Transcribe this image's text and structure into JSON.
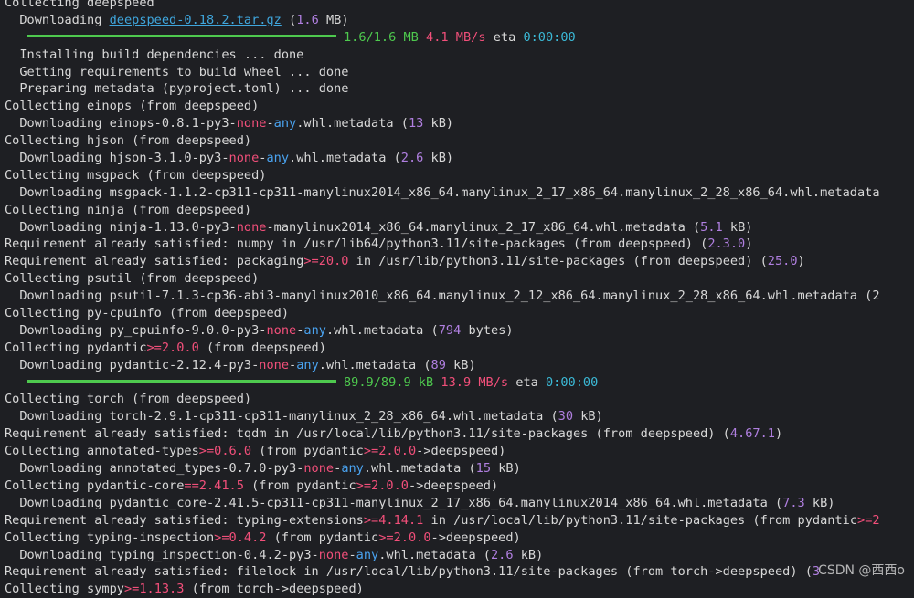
{
  "terminal": {
    "lines": [
      [
        [
          "Collecting deepspeed",
          ""
        ]
      ],
      [
        [
          "  Downloading ",
          ""
        ],
        [
          "deepspeed-0.18.2.tar.gz",
          "u"
        ],
        [
          " (",
          ""
        ],
        [
          "1.6",
          "m"
        ],
        [
          " MB)",
          ""
        ]
      ],
      [
        [
          "__BAR__",
          ""
        ],
        [
          "1.6/1.6 MB",
          "g"
        ],
        [
          " ",
          ""
        ],
        [
          "4.1 MB/s",
          "r"
        ],
        [
          " eta ",
          ""
        ],
        [
          "0:00:00",
          "c"
        ]
      ],
      [
        [
          "  Installing build dependencies ... done",
          ""
        ]
      ],
      [
        [
          "  Getting requirements to build wheel ... done",
          ""
        ]
      ],
      [
        [
          "  Preparing metadata (pyproject.toml) ... done",
          ""
        ]
      ],
      [
        [
          "Collecting einops (from deepspeed)",
          ""
        ]
      ],
      [
        [
          "  Downloading einops-0.8.1-py3-",
          ""
        ],
        [
          "none",
          "r"
        ],
        [
          "-",
          ""
        ],
        [
          "any",
          "b"
        ],
        [
          ".whl.metadata (",
          ""
        ],
        [
          "13",
          "m"
        ],
        [
          " kB)",
          ""
        ]
      ],
      [
        [
          "Collecting hjson (from deepspeed)",
          ""
        ]
      ],
      [
        [
          "  Downloading hjson-3.1.0-py3-",
          ""
        ],
        [
          "none",
          "r"
        ],
        [
          "-",
          ""
        ],
        [
          "any",
          "b"
        ],
        [
          ".whl.metadata (",
          ""
        ],
        [
          "2.6",
          "m"
        ],
        [
          " kB)",
          ""
        ]
      ],
      [
        [
          "Collecting msgpack (from deepspeed)",
          ""
        ]
      ],
      [
        [
          "  Downloading msgpack-1.1.2-cp311-cp311-manylinux2014_x86_64.manylinux_2_17_x86_64.manylinux_2_28_x86_64.whl.metadata",
          ""
        ]
      ],
      [
        [
          "Collecting ninja (from deepspeed)",
          ""
        ]
      ],
      [
        [
          "  Downloading ninja-1.13.0-py3-",
          ""
        ],
        [
          "none",
          "r"
        ],
        [
          "-manylinux2014_x86_64.manylinux_2_17_x86_64.whl.metadata (",
          ""
        ],
        [
          "5.1",
          "m"
        ],
        [
          " kB)",
          ""
        ]
      ],
      [
        [
          "Requirement already satisfied: numpy in /usr/lib64/python3.11/site-packages (from deepspeed) (",
          ""
        ],
        [
          "2.3.0",
          "m"
        ],
        [
          ")",
          ""
        ]
      ],
      [
        [
          "Requirement already satisfied: packaging",
          ""
        ],
        [
          ">=20.0",
          "r"
        ],
        [
          " in /usr/lib/python3.11/site-packages (from deepspeed) (",
          ""
        ],
        [
          "25.0",
          "m"
        ],
        [
          ")",
          ""
        ]
      ],
      [
        [
          "Collecting psutil (from deepspeed)",
          ""
        ]
      ],
      [
        [
          "  Downloading psutil-7.1.3-cp36-abi3-manylinux2010_x86_64.manylinux_2_12_x86_64.manylinux_2_28_x86_64.whl.metadata (2",
          ""
        ]
      ],
      [
        [
          "Collecting py-cpuinfo (from deepspeed)",
          ""
        ]
      ],
      [
        [
          "  Downloading py_cpuinfo-9.0.0-py3-",
          ""
        ],
        [
          "none",
          "r"
        ],
        [
          "-",
          ""
        ],
        [
          "any",
          "b"
        ],
        [
          ".whl.metadata (",
          ""
        ],
        [
          "794",
          "m"
        ],
        [
          " bytes)",
          ""
        ]
      ],
      [
        [
          "Collecting pydantic",
          ""
        ],
        [
          ">=2.0.0",
          "r"
        ],
        [
          " (from deepspeed)",
          ""
        ]
      ],
      [
        [
          "  Downloading pydantic-2.12.4-py3-",
          ""
        ],
        [
          "none",
          "r"
        ],
        [
          "-",
          ""
        ],
        [
          "any",
          "b"
        ],
        [
          ".whl.metadata (",
          ""
        ],
        [
          "89",
          "m"
        ],
        [
          " kB)",
          ""
        ]
      ],
      [
        [
          "__BAR__",
          ""
        ],
        [
          "89.9/89.9 kB",
          "g"
        ],
        [
          " ",
          ""
        ],
        [
          "13.9 MB/s",
          "r"
        ],
        [
          " eta ",
          ""
        ],
        [
          "0:00:00",
          "c"
        ]
      ],
      [
        [
          "Collecting torch (from deepspeed)",
          ""
        ]
      ],
      [
        [
          "  Downloading torch-2.9.1-cp311-cp311-manylinux_2_28_x86_64.whl.metadata (",
          ""
        ],
        [
          "30",
          "m"
        ],
        [
          " kB)",
          ""
        ]
      ],
      [
        [
          "Requirement already satisfied: tqdm in /usr/local/lib/python3.11/site-packages (from deepspeed) (",
          ""
        ],
        [
          "4.67.1",
          "m"
        ],
        [
          ")",
          ""
        ]
      ],
      [
        [
          "Collecting annotated-types",
          ""
        ],
        [
          ">=0.6.0",
          "r"
        ],
        [
          " (from pydantic",
          ""
        ],
        [
          ">=2.0.0",
          "r"
        ],
        [
          "->deepspeed)",
          ""
        ]
      ],
      [
        [
          "  Downloading annotated_types-0.7.0-py3-",
          ""
        ],
        [
          "none",
          "r"
        ],
        [
          "-",
          ""
        ],
        [
          "any",
          "b"
        ],
        [
          ".whl.metadata (",
          ""
        ],
        [
          "15",
          "m"
        ],
        [
          " kB)",
          ""
        ]
      ],
      [
        [
          "Collecting pydantic-core",
          ""
        ],
        [
          "==2.41.5",
          "r"
        ],
        [
          " (from pydantic",
          ""
        ],
        [
          ">=2.0.0",
          "r"
        ],
        [
          "->deepspeed)",
          ""
        ]
      ],
      [
        [
          "  Downloading pydantic_core-2.41.5-cp311-cp311-manylinux_2_17_x86_64.manylinux2014_x86_64.whl.metadata (",
          ""
        ],
        [
          "7.3",
          "m"
        ],
        [
          " kB)",
          ""
        ]
      ],
      [
        [
          "Requirement already satisfied: typing-extensions",
          ""
        ],
        [
          ">=4.14.1",
          "r"
        ],
        [
          " in /usr/local/lib/python3.11/site-packages (from pydantic",
          ""
        ],
        [
          ">=2",
          "r"
        ]
      ],
      [
        [
          "Collecting typing-inspection",
          ""
        ],
        [
          ">=0.4.2",
          "r"
        ],
        [
          " (from pydantic",
          ""
        ],
        [
          ">=2.0.0",
          "r"
        ],
        [
          "->deepspeed)",
          ""
        ]
      ],
      [
        [
          "  Downloading typing_inspection-0.4.2-py3-",
          ""
        ],
        [
          "none",
          "r"
        ],
        [
          "-",
          ""
        ],
        [
          "any",
          "b"
        ],
        [
          ".whl.metadata (",
          ""
        ],
        [
          "2.6",
          "m"
        ],
        [
          " kB)",
          ""
        ]
      ],
      [
        [
          "Requirement already satisfied: filelock in /usr/local/lib/python3.11/site-packages (from torch",
          ""
        ],
        [
          "->deepspeed) (",
          ""
        ],
        [
          "3",
          "m"
        ]
      ],
      [
        [
          "Collecting sympy",
          ""
        ],
        [
          ">=1.13.3",
          "r"
        ],
        [
          " (from torch->deepspeed)",
          ""
        ]
      ]
    ]
  },
  "watermark": "CSDN @西西o"
}
